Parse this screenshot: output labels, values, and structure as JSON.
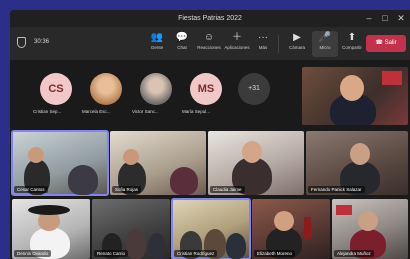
{
  "window": {
    "title": "Fiestas Patrias 2022"
  },
  "toolbar": {
    "timer": "30:36",
    "tools": [
      {
        "label": "Gente",
        "icon": "people-icon"
      },
      {
        "label": "Chat",
        "icon": "chat-icon"
      },
      {
        "label": "Reacciones",
        "icon": "reactions-icon"
      },
      {
        "label": "Aplicaciones",
        "icon": "apps-icon"
      },
      {
        "label": "Más",
        "icon": "more-icon"
      },
      {
        "label": "Cámara",
        "icon": "camera-icon"
      },
      {
        "label": "Micro",
        "icon": "mic-icon"
      },
      {
        "label": "Compartir",
        "icon": "share-icon"
      }
    ],
    "leave_label": "Salir"
  },
  "avatars": [
    {
      "initials": "CS",
      "name": "Cristian Sep...",
      "color": "#f0c8c8",
      "text_color": "#7a2b2b"
    },
    {
      "initials": "",
      "name": "Marcela Esc...",
      "color": "#d9b48f",
      "text_color": "#333"
    },
    {
      "initials": "",
      "name": "Victor Sanc...",
      "color": "#cfcfcf",
      "text_color": "#333"
    },
    {
      "initials": "MS",
      "name": "María Sepul...",
      "color": "#f0c8c8",
      "text_color": "#7a2b2b"
    }
  ],
  "more_count": "+31",
  "tiles": [
    {
      "name": "Cesar Cantos"
    },
    {
      "name": "Sofia Rojas"
    },
    {
      "name": "Claudia Jaime"
    },
    {
      "name": "Fernando Panick Salazar"
    },
    {
      "name": "Dennis Ovando"
    },
    {
      "name": "Renato Carrio"
    },
    {
      "name": "Cristian Rodríguez"
    },
    {
      "name": "Elizabeth Moreno"
    },
    {
      "name": "Alejandra Muñoz"
    },
    {
      "name": ""
    }
  ]
}
